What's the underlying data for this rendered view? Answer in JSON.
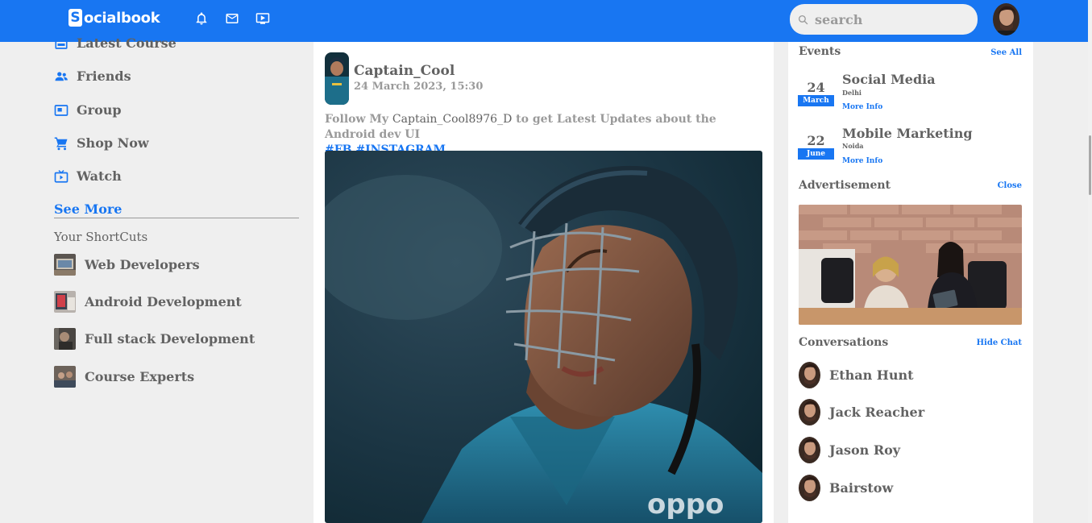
{
  "app": {
    "logo_letter": "S",
    "logo_text": "ocialbook",
    "brand_color": "#1876f2"
  },
  "navbar": {
    "icons": [
      "bell-icon",
      "mail-icon",
      "video-icon"
    ],
    "search_placeholder": "search"
  },
  "left_sidebar": {
    "items": [
      {
        "label": "Latest Course",
        "icon": "news-icon"
      },
      {
        "label": "Friends",
        "icon": "friends-icon"
      },
      {
        "label": "Group",
        "icon": "group-icon"
      },
      {
        "label": "Shop Now",
        "icon": "cart-icon"
      },
      {
        "label": "Watch",
        "icon": "tv-icon"
      }
    ],
    "see_more": "See More",
    "shortcuts_title": "Your ShortCuts",
    "shortcuts": [
      {
        "label": "Web Developers"
      },
      {
        "label": "Android Development"
      },
      {
        "label": "Full stack Development"
      },
      {
        "label": "Course Experts"
      }
    ]
  },
  "post": {
    "user": "Captain_Cool",
    "time": "24 March 2023, 15:30",
    "text_before": "Follow My ",
    "handle": "Captain_Cool8976_D",
    "text_after": " to get Latest Updates about the Android dev UI",
    "tags": "#FB #INSTAGRAM"
  },
  "right_sidebar": {
    "events_title": "Events",
    "events_link": "See All",
    "events": [
      {
        "day": "24",
        "month": "March",
        "name": "Social Media",
        "location": "Delhi",
        "info": "More Info"
      },
      {
        "day": "22",
        "month": "June",
        "name": "Mobile Marketing",
        "location": "Noida",
        "info": "More Info"
      }
    ],
    "ad_title": "Advertisement",
    "ad_link": "Close",
    "conversations_title": "Conversations",
    "conversations_link": "Hide Chat",
    "contacts": [
      {
        "name": "Ethan Hunt"
      },
      {
        "name": "Jack Reacher"
      },
      {
        "name": "Jason Roy"
      },
      {
        "name": "Bairstow"
      }
    ]
  }
}
